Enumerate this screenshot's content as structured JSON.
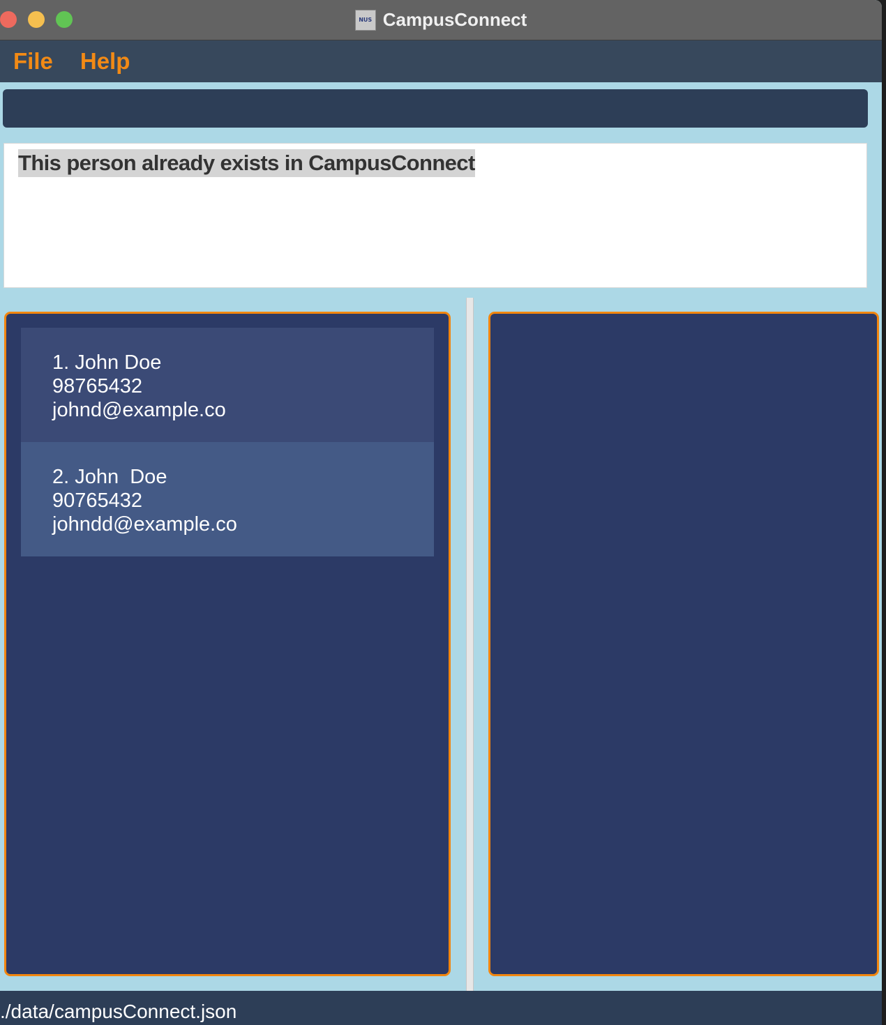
{
  "window": {
    "title": "CampusConnect",
    "app_icon_text": "NUS"
  },
  "menu": {
    "items": [
      {
        "label": "File"
      },
      {
        "label": "Help"
      }
    ]
  },
  "command_box": {
    "value": "",
    "placeholder": ""
  },
  "result_display": {
    "message": "This person already exists in CampusConnect"
  },
  "person_list": {
    "persons": [
      {
        "name_line": "1. John Doe",
        "phone": "98765432",
        "email": "johnd@example.co"
      },
      {
        "name_line": "2. John  Doe",
        "phone": "90765432",
        "email": "johndd@example.co"
      }
    ]
  },
  "status_bar": {
    "save_location": "./data/campusConnect.json"
  },
  "colors": {
    "accent_orange": "#f28a15",
    "panel_background": "#2c3a66",
    "window_background": "#acd8e6",
    "menu_background": "#37485c"
  }
}
